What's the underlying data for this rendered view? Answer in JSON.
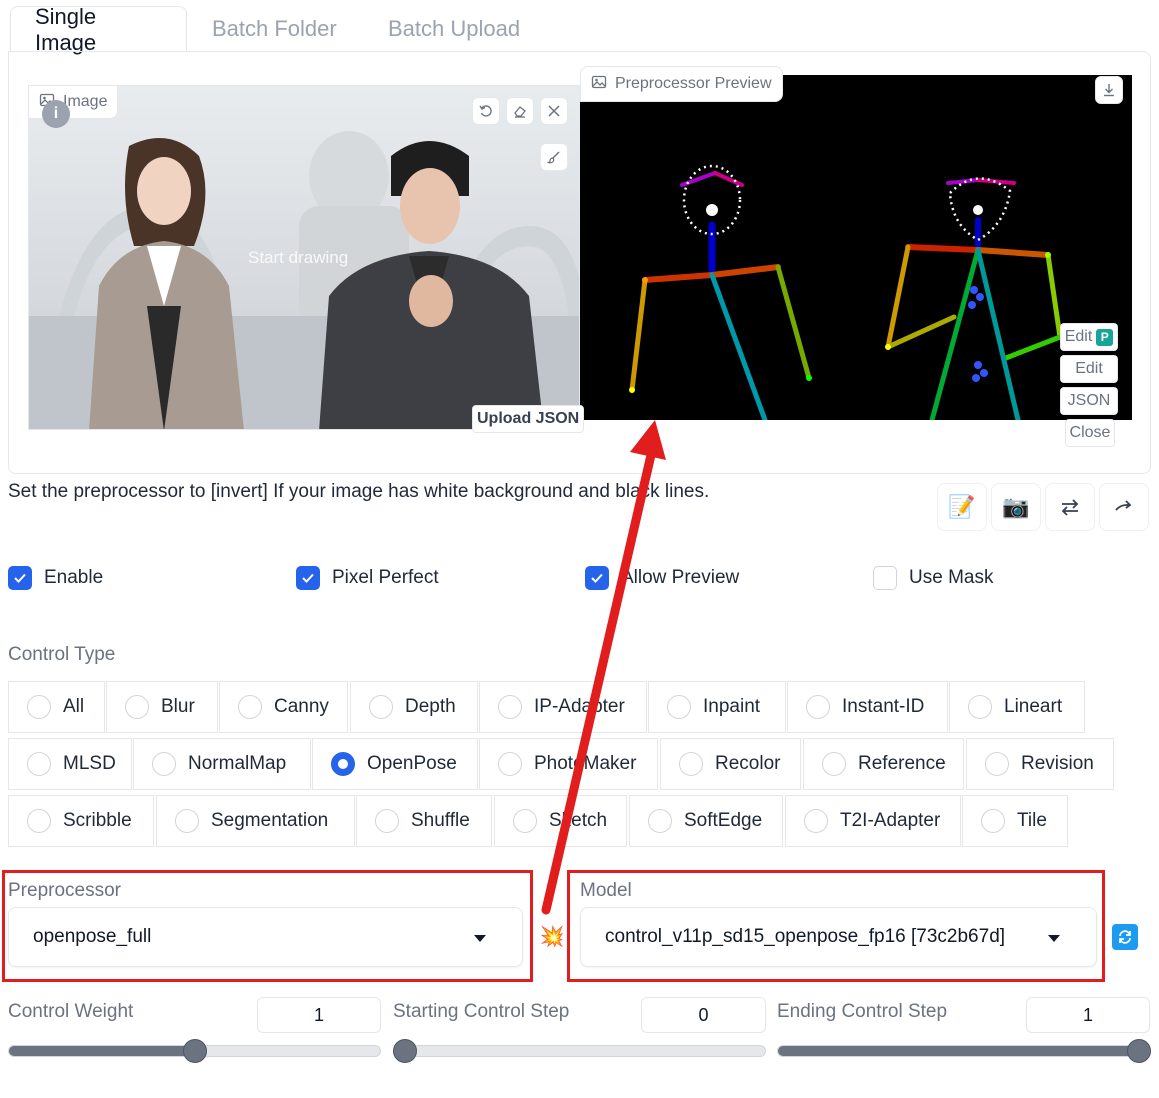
{
  "tabs": [
    "Single Image",
    "Batch Folder",
    "Batch Upload"
  ],
  "image_block": {
    "label": "Image",
    "placeholder_text": "Start drawing",
    "upload_json": "Upload JSON"
  },
  "preview_block": {
    "label": "Preprocessor Preview",
    "buttons": [
      "Edit",
      "Edit",
      "JSON",
      "Close"
    ]
  },
  "hint": "Set the preprocessor to [invert] If your image has white background and black lines.",
  "checkboxes": [
    {
      "label": "Enable",
      "checked": true
    },
    {
      "label": "Pixel Perfect",
      "checked": true
    },
    {
      "label": "Allow Preview",
      "checked": true
    },
    {
      "label": "Use Mask",
      "checked": false
    }
  ],
  "control_type": {
    "label": "Control Type",
    "options": [
      "All",
      "Blur",
      "Canny",
      "Depth",
      "IP-Adapter",
      "Inpaint",
      "Instant-ID",
      "Lineart",
      "MLSD",
      "NormalMap",
      "OpenPose",
      "PhotoMaker",
      "Recolor",
      "Reference",
      "Revision",
      "Scribble",
      "Segmentation",
      "Shuffle",
      "Sketch",
      "SoftEdge",
      "T2I-Adapter",
      "Tile"
    ],
    "selected": "OpenPose"
  },
  "preprocessor": {
    "label": "Preprocessor",
    "value": "openpose_full"
  },
  "model": {
    "label": "Model",
    "value": "control_v11p_sd15_openpose_fp16 [73c2b67d]"
  },
  "sliders": [
    {
      "label": "Control Weight",
      "value": "1",
      "fraction": 0.55
    },
    {
      "label": "Starting Control Step",
      "value": "0",
      "fraction": 0.0
    },
    {
      "label": "Ending Control Step",
      "value": "1",
      "fraction": 1.0
    }
  ],
  "icons": {
    "image_label": "image-icon",
    "undo": "undo-icon",
    "eraser": "eraser-icon",
    "close": "close-icon",
    "brush": "brush-icon",
    "download": "download-icon",
    "tools": [
      "edit-document-icon",
      "camera-icon",
      "swap-icon",
      "send-dimensions-icon"
    ],
    "run": "explosion-icon",
    "refresh": "refresh-icon"
  },
  "colors": {
    "accent": "#2563eb",
    "annotation": "#e11d1d"
  }
}
